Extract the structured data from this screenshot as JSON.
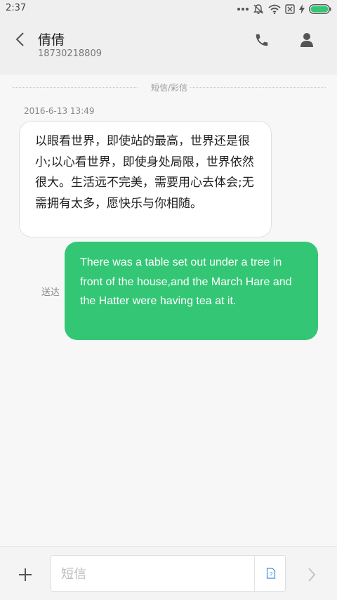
{
  "status_bar": {
    "time": "2:37",
    "icons": [
      "more-dots-icon",
      "bell-muted-icon",
      "wifi-icon",
      "sim-off-icon",
      "charging-icon",
      "battery-icon"
    ],
    "battery_color": "#33c775"
  },
  "header": {
    "contact_name": "倩倩",
    "contact_number": "18730218809"
  },
  "conversation": {
    "divider_label": "短信/彩信",
    "timestamp": "2016-6-13 13:49",
    "incoming_message": "以眼看世界，即使站的最高，世界还是很小;以心看世界，即使身处局限，世界依然很大。生活远不完美，需要用心去体会;无需拥有太多，愿快乐与你相随。",
    "outgoing_status": "送达",
    "outgoing_message": "There was a table set out under a tree in front of the house,and the March Hare and the Hatter were having tea at it.",
    "outgoing_bubble_color": "#33c775"
  },
  "composer": {
    "placeholder": "短信"
  }
}
